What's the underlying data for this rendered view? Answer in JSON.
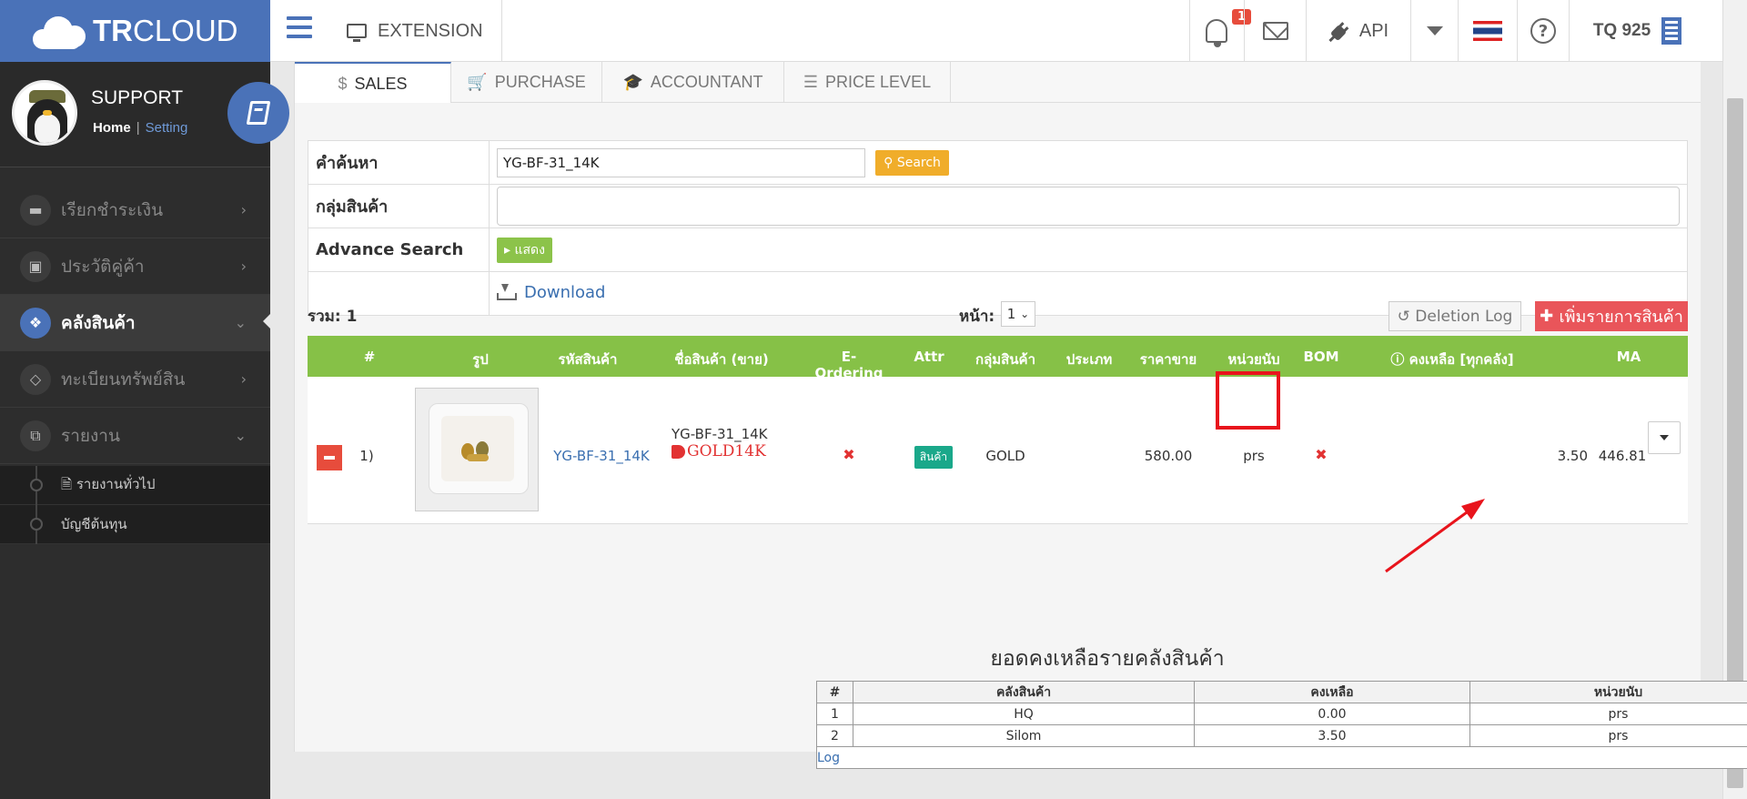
{
  "brand": {
    "bold": "TR",
    "light": "CLOUD"
  },
  "profile": {
    "name": "SUPPORT",
    "home": "Home",
    "setting": "Setting"
  },
  "sidebar": {
    "items": [
      {
        "label": "เรียกชำระเงิน",
        "icon": "card-icon"
      },
      {
        "label": "ประวัติคู่ค้า",
        "icon": "contact-icon"
      },
      {
        "label": "คลังสินค้า",
        "icon": "boxes-icon"
      },
      {
        "label": "ทะเบียนทรัพย์สิน",
        "icon": "diamond-icon"
      },
      {
        "label": "รายงาน",
        "icon": "report-icon"
      }
    ],
    "subitems": [
      {
        "label": "รายงานทั่วไป",
        "icon": "document-icon"
      },
      {
        "label": "บัญชีต้นทุน"
      }
    ]
  },
  "topbar": {
    "extension": "EXTENSION",
    "notification_count": "1",
    "api": "API",
    "company": "TQ 925",
    "help": "?"
  },
  "tabs": [
    {
      "label": "SALES",
      "icon": "$"
    },
    {
      "label": "PURCHASE",
      "icon": "cart-icon"
    },
    {
      "label": "ACCOUNTANT",
      "icon": "graduation-icon"
    },
    {
      "label": "PRICE LEVEL",
      "icon": "list-icon"
    }
  ],
  "search": {
    "keyword_label": "คำค้นหา",
    "keyword_value": "YG-BF-31_14K",
    "search_button": "Search",
    "group_label": "กลุ่มสินค้า",
    "group_value": "",
    "advance_label": "Advance Search",
    "show_button": "แสดง",
    "download": "Download"
  },
  "list": {
    "total": "รวม: 1",
    "page_label": "หน้า:",
    "page_value": "1",
    "deletion_log": "Deletion Log",
    "add_product": "เพิ่มรายการสินค้า"
  },
  "columns": [
    "#",
    "รูป",
    "รหัสสินค้า",
    "ชื่อสินค้า (ขาย)",
    "E-Ordering",
    "Attr",
    "กลุ่มสินค้า",
    "ประเภท",
    "ราคาขาย",
    "หน่วยนับ",
    "BOM",
    "คงเหลือ [ทุกคลัง]",
    "MA"
  ],
  "product": {
    "index": "1)",
    "code": "YG-BF-31_14K",
    "name": "YG-BF-31_14K",
    "tag": "GOLD14K",
    "e_ordering": "✖",
    "attr": "สินค้า",
    "group": "GOLD",
    "type": "",
    "price": "580.00",
    "unit": "prs",
    "bom": "✖",
    "stock": "3.50",
    "ma": "446.81"
  },
  "warehouse": {
    "title": "ยอดคงเหลือรายคลังสินค้า",
    "headers": [
      "#",
      "คลังสินค้า",
      "คงเหลือ",
      "หน่วยนับ"
    ],
    "rows": [
      [
        "1",
        "HQ",
        "0.00",
        "prs"
      ],
      [
        "2",
        "Silom",
        "3.50",
        "prs"
      ]
    ],
    "log": "Log"
  },
  "colors": {
    "brand_blue": "#4a72b8",
    "table_header_green": "#86c147",
    "search_orange": "#f0ad2a",
    "add_red": "#e9555a",
    "highlight_red": "#e8141c"
  }
}
